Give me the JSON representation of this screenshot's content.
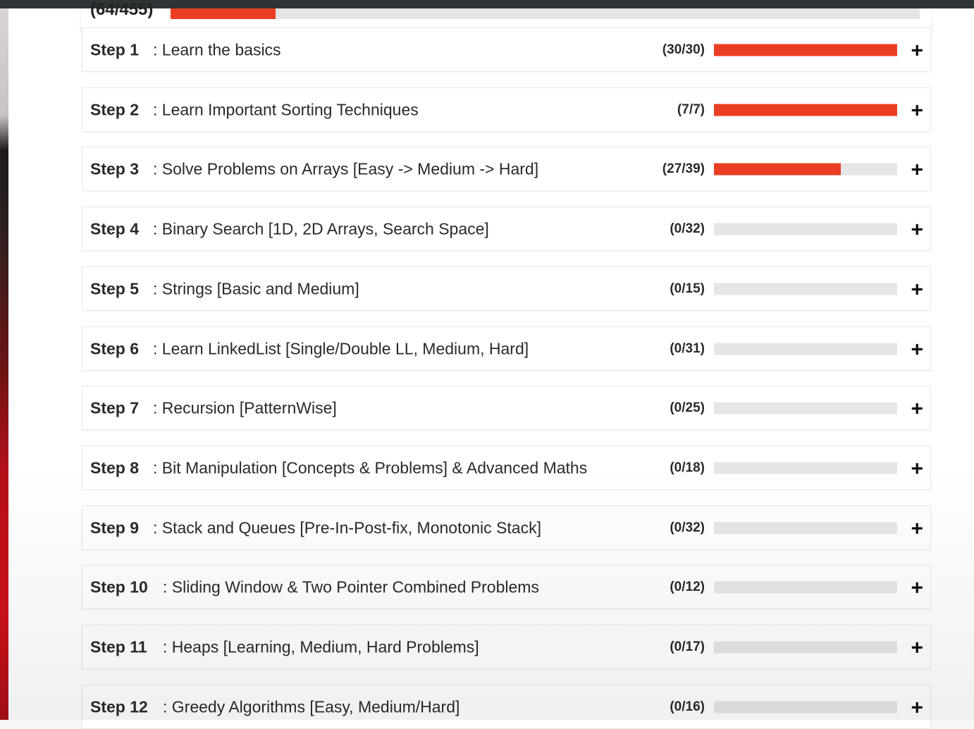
{
  "overall": {
    "count_text": "(64/455)",
    "progress": 0.14
  },
  "steps": [
    {
      "label": "Step 1",
      "title": ": Learn the basics",
      "count_text": "(30/30)",
      "progress": 1.0
    },
    {
      "label": "Step 2",
      "title": ": Learn Important Sorting Techniques",
      "count_text": "(7/7)",
      "progress": 1.0
    },
    {
      "label": "Step 3",
      "title": ": Solve Problems on Arrays [Easy -> Medium -> Hard]",
      "count_text": "(27/39)",
      "progress": 0.6923
    },
    {
      "label": "Step 4",
      "title": ": Binary Search [1D, 2D Arrays, Search Space]",
      "count_text": "(0/32)",
      "progress": 0
    },
    {
      "label": "Step 5",
      "title": ": Strings [Basic and Medium]",
      "count_text": "(0/15)",
      "progress": 0
    },
    {
      "label": "Step 6",
      "title": ": Learn LinkedList [Single/Double LL, Medium, Hard]",
      "count_text": "(0/31)",
      "progress": 0
    },
    {
      "label": "Step 7",
      "title": ": Recursion [PatternWise]",
      "count_text": "(0/25)",
      "progress": 0
    },
    {
      "label": "Step 8",
      "title": ": Bit Manipulation [Concepts & Problems] & Advanced Maths",
      "count_text": "(0/18)",
      "progress": 0
    },
    {
      "label": "Step 9",
      "title": ": Stack and Queues [Pre-In-Post-fix, Monotonic Stack]",
      "count_text": "(0/32)",
      "progress": 0
    },
    {
      "label": "Step 10",
      "title": ": Sliding Window & Two Pointer Combined Problems",
      "count_text": "(0/12)",
      "progress": 0
    },
    {
      "label": "Step 11",
      "title": ": Heaps [Learning, Medium, Hard Problems]",
      "count_text": "(0/17)",
      "progress": 0
    },
    {
      "label": "Step 12",
      "title": ": Greedy Algorithms [Easy, Medium/Hard]",
      "count_text": "(0/16)",
      "progress": 0
    }
  ],
  "icons": {
    "expand": "plus-icon",
    "expand_glyph": "+"
  },
  "colors": {
    "progress_fill": "#ea3e23",
    "progress_track": "#e6e6e6"
  }
}
